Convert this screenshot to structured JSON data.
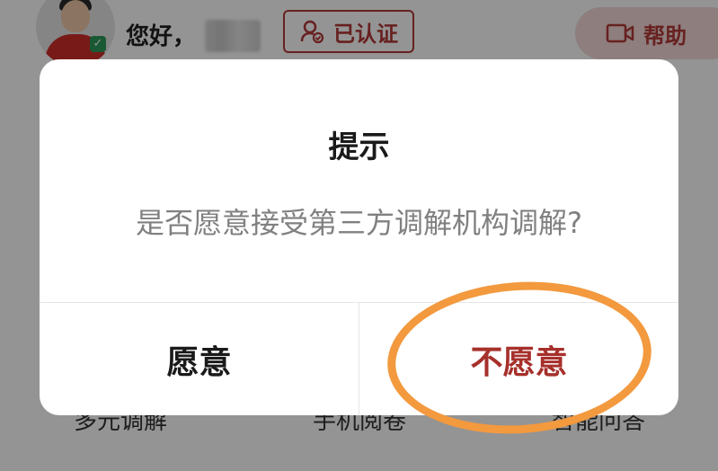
{
  "header": {
    "greeting": "您好，",
    "verified_label": "已认证",
    "help_label": "帮助"
  },
  "bottom_menu": {
    "items": [
      "多元调解",
      "手机阅卷",
      "智能问答"
    ]
  },
  "dialog": {
    "title": "提示",
    "message": "是否愿意接受第三方调解机构调解?",
    "agree_label": "愿意",
    "decline_label": "不愿意"
  },
  "colors": {
    "accent": "#b23a37",
    "decline_text": "#a6302b",
    "annotation": "#f3993e",
    "message_text": "#808080"
  },
  "icons": {
    "verified": "user-check-icon",
    "help": "video-camera-icon"
  }
}
